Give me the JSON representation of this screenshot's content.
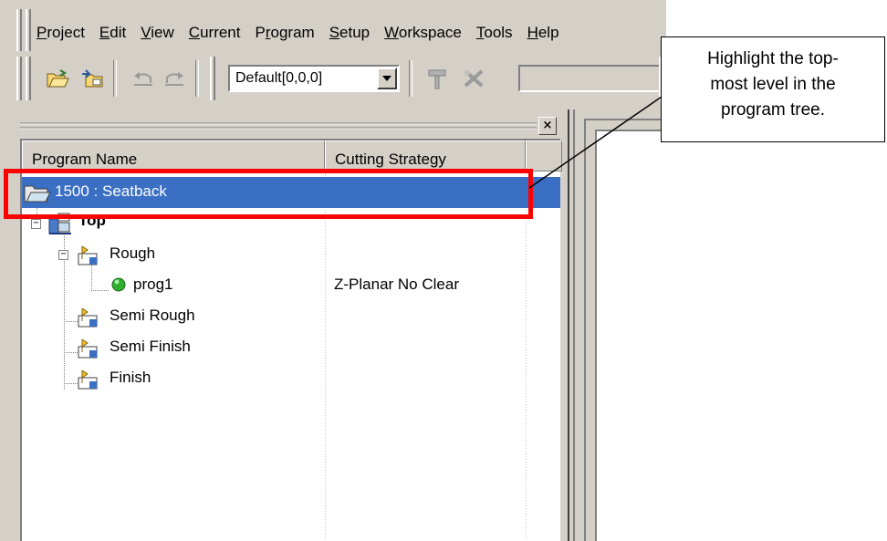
{
  "menu": [
    {
      "label": "Project",
      "u": 0
    },
    {
      "label": "Edit",
      "u": 0
    },
    {
      "label": "View",
      "u": 0
    },
    {
      "label": "Current",
      "u": 0
    },
    {
      "label": "Program",
      "u": 1
    },
    {
      "label": "Setup",
      "u": 0
    },
    {
      "label": "Workspace",
      "u": 0
    },
    {
      "label": "Tools",
      "u": 0
    },
    {
      "label": "Help",
      "u": 0
    }
  ],
  "toolbar": {
    "combo_value": "Default[0,0,0]"
  },
  "tree": {
    "columns": [
      "Program Name",
      "Cutting Strategy"
    ],
    "rows": [
      {
        "name": "1500 : Seatback",
        "strategy": "",
        "icon": "folder-open-icon",
        "selected": true
      },
      {
        "name": "Top",
        "strategy": "",
        "icon": "program-group-icon",
        "bold": true
      },
      {
        "name": "Rough",
        "strategy": "",
        "icon": "stage-icon"
      },
      {
        "name": "prog1",
        "strategy": "Z-Planar No Clear",
        "icon": "green-status-icon"
      },
      {
        "name": "Semi Rough",
        "strategy": "",
        "icon": "stage-icon"
      },
      {
        "name": "Semi Finish",
        "strategy": "",
        "icon": "stage-icon"
      },
      {
        "name": "Finish",
        "strategy": "",
        "icon": "stage-icon"
      }
    ]
  },
  "callout": {
    "line1": "Highlight the top-",
    "line2": "most level in the",
    "line3": "program tree."
  },
  "colors": {
    "selection": "#3a6fc4",
    "highlight": "#ff0000",
    "chrome": "#d4d0c8"
  }
}
